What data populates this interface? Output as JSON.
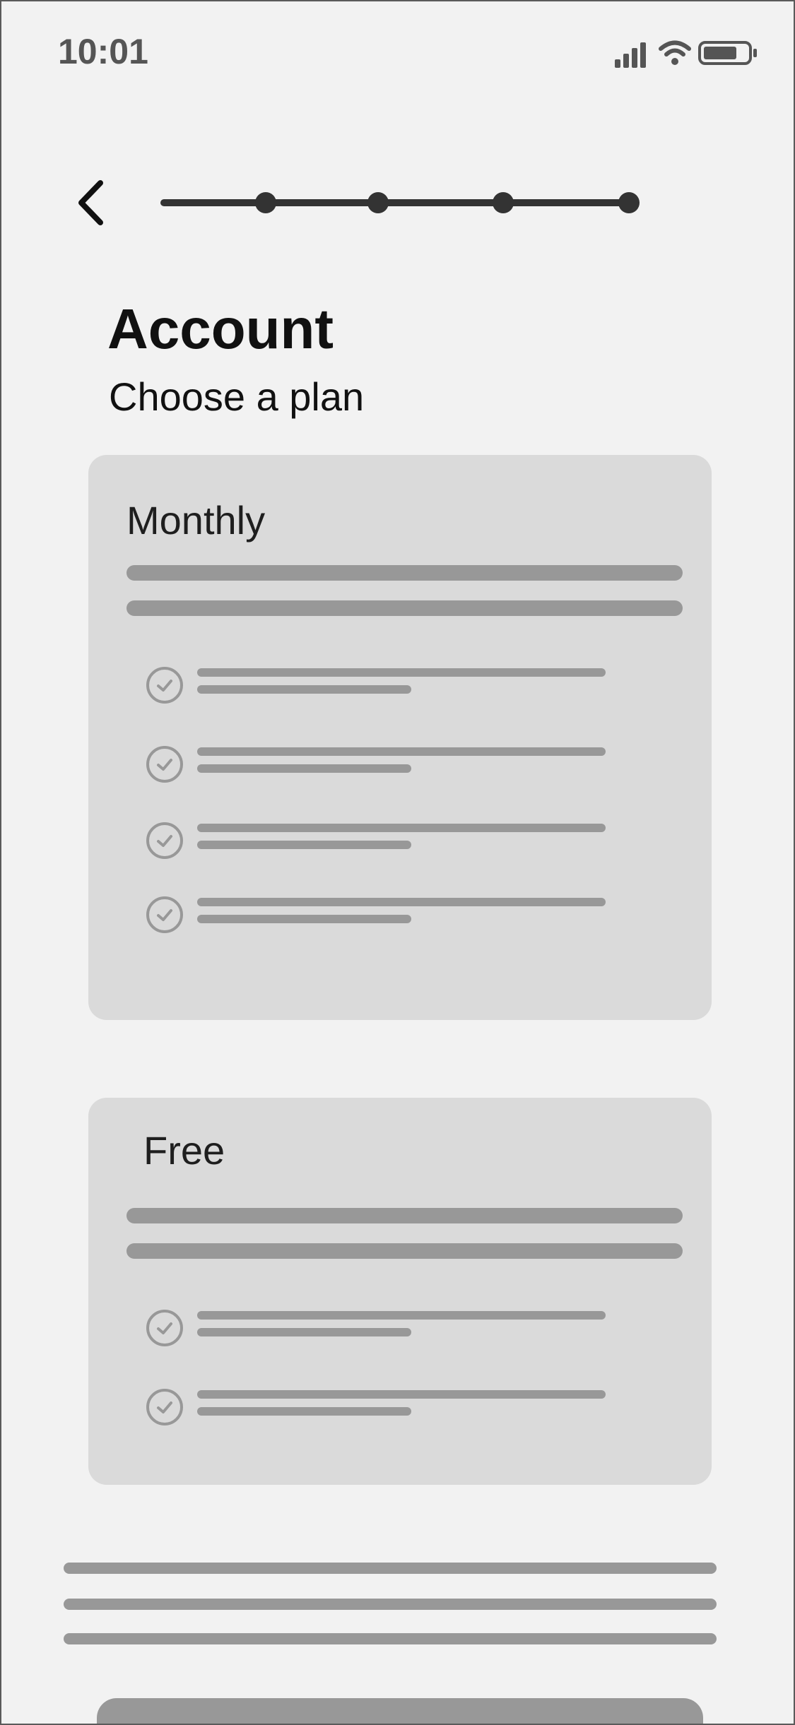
{
  "status_bar": {
    "time": "10:01",
    "icons": [
      "signal-icon",
      "wifi-icon",
      "battery-icon"
    ]
  },
  "header": {
    "back_icon": "chevron-left-icon",
    "stepper": {
      "steps": 4,
      "current": 4
    }
  },
  "page": {
    "title": "Account",
    "subtitle": "Choose a plan"
  },
  "plans": [
    {
      "name": "Monthly",
      "feature_count": 4
    },
    {
      "name": "Free",
      "feature_count": 2
    }
  ],
  "colors": {
    "background": "#f2f2f2",
    "card": "#dadada",
    "placeholder": "#989898",
    "text": "#111111",
    "stepper": "#333333"
  }
}
